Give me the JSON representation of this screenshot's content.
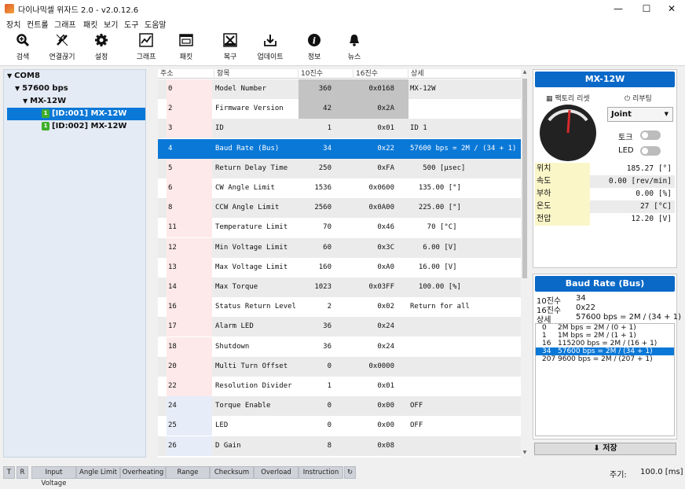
{
  "window": {
    "title": "다이나믹셀 위자드 2.0 - v2.0.12.6",
    "controls": [
      "—",
      "☐",
      "✕"
    ]
  },
  "menu": [
    "장치",
    "컨트롤",
    "그래프",
    "패킷",
    "보기",
    "도구",
    "도움말"
  ],
  "toolbar": {
    "items": [
      {
        "label": "검색",
        "icon": "search-icon"
      },
      {
        "label": "연결끊기",
        "icon": "disconnect-icon"
      },
      {
        "label": "설정",
        "icon": "gear-icon"
      },
      {
        "label": "그래프",
        "icon": "graph-icon"
      },
      {
        "label": "패킷",
        "icon": "packet-icon"
      },
      {
        "label": "복구",
        "icon": "recovery-icon"
      },
      {
        "label": "업데이트",
        "icon": "update-icon"
      },
      {
        "label": "정보",
        "icon": "info-icon"
      },
      {
        "label": "뉴스",
        "icon": "bell-icon"
      }
    ]
  },
  "tree": {
    "port": "COM8",
    "baud": "57600 bps",
    "model": "MX-12W",
    "devices": [
      {
        "label": "[ID:001] MX-12W",
        "badge": "1",
        "selected": true
      },
      {
        "label": "[ID:002] MX-12W",
        "badge": "1",
        "selected": false
      }
    ]
  },
  "table": {
    "headers": [
      "주소",
      "항목",
      "10진수",
      "16진수",
      "상세"
    ],
    "rows": [
      {
        "addr": "0",
        "name": "Model Number",
        "dec": "360",
        "hex": "0x0168",
        "detail": "MX-12W",
        "ro": true
      },
      {
        "addr": "2",
        "name": "Firmware Version",
        "dec": "42",
        "hex": "0x2A",
        "detail": "",
        "ro": true
      },
      {
        "addr": "3",
        "name": "ID",
        "dec": "1",
        "hex": "0x01",
        "detail": "ID 1"
      },
      {
        "addr": "4",
        "name": "Baud Rate (Bus)",
        "dec": "34",
        "hex": "0x22",
        "detail": "57600 bps = 2M / (34 + 1)",
        "selected": true
      },
      {
        "addr": "5",
        "name": "Return Delay Time",
        "dec": "250",
        "hex": "0xFA",
        "detail": "   500 [µsec]"
      },
      {
        "addr": "6",
        "name": "CW Angle Limit",
        "dec": "1536",
        "hex": "0x0600",
        "detail": "  135.00 [°]"
      },
      {
        "addr": "8",
        "name": "CCW Angle Limit",
        "dec": "2560",
        "hex": "0x0A00",
        "detail": "  225.00 [°]"
      },
      {
        "addr": "11",
        "name": "Temperature Limit",
        "dec": "70",
        "hex": "0x46",
        "detail": "    70 [°C]"
      },
      {
        "addr": "12",
        "name": "Min Voltage Limit",
        "dec": "60",
        "hex": "0x3C",
        "detail": "   6.00 [V]"
      },
      {
        "addr": "13",
        "name": "Max Voltage Limit",
        "dec": "160",
        "hex": "0xA0",
        "detail": "  16.00 [V]"
      },
      {
        "addr": "14",
        "name": "Max Torque",
        "dec": "1023",
        "hex": "0x03FF",
        "detail": "  100.00 [%]"
      },
      {
        "addr": "16",
        "name": "Status Return Level",
        "dec": "2",
        "hex": "0x02",
        "detail": "Return for all"
      },
      {
        "addr": "17",
        "name": "Alarm LED",
        "dec": "36",
        "hex": "0x24",
        "detail": ""
      },
      {
        "addr": "18",
        "name": "Shutdown",
        "dec": "36",
        "hex": "0x24",
        "detail": ""
      },
      {
        "addr": "20",
        "name": "Multi Turn Offset",
        "dec": "0",
        "hex": "0x0000",
        "detail": ""
      },
      {
        "addr": "22",
        "name": "Resolution Divider",
        "dec": "1",
        "hex": "0x01",
        "detail": ""
      },
      {
        "addr": "24",
        "name": "Torque Enable",
        "dec": "0",
        "hex": "0x00",
        "detail": "OFF",
        "ram": true
      },
      {
        "addr": "25",
        "name": "LED",
        "dec": "0",
        "hex": "0x00",
        "detail": "OFF",
        "ram": true
      },
      {
        "addr": "26",
        "name": "D Gain",
        "dec": "8",
        "hex": "0x08",
        "detail": "",
        "ram": true
      }
    ]
  },
  "device_panel": {
    "title": "MX-12W",
    "factory_reset": "팩토리 리셋",
    "reboot": "리부팅",
    "mode": "Joint",
    "torque_label": "토크",
    "led_label": "LED",
    "torque_on": false,
    "led_on": false,
    "status": [
      {
        "label": "위치",
        "value": "185.27 [°]"
      },
      {
        "label": "속도",
        "value": "0.00 [rev/min]"
      },
      {
        "label": "부하",
        "value": "0.00 [%]"
      },
      {
        "label": "온도",
        "value": "27 [°C]"
      },
      {
        "label": "전압",
        "value": "12.20 [V]"
      }
    ]
  },
  "item_panel": {
    "title": "Baud Rate (Bus)",
    "dec_label": "10진수",
    "dec_value": "34",
    "hex_label": "16진수",
    "hex_value": "0x22",
    "detail_label": "상세",
    "detail_value": "57600 bps = 2M / (34 + 1)",
    "options": [
      {
        "k": "0",
        "v": "2M bps = 2M / (0 + 1)"
      },
      {
        "k": "1",
        "v": "1M bps = 2M / (1 + 1)"
      },
      {
        "k": "16",
        "v": "115200 bps = 2M / (16 + 1)"
      },
      {
        "k": "34",
        "v": "57600 bps = 2M / (34 + 1)",
        "selected": true
      },
      {
        "k": "207",
        "v": "9600 bps = 2M / (207 + 1)"
      }
    ],
    "save_label": "저장"
  },
  "statusbar": {
    "t_btn": "T",
    "r_btn": "R",
    "flags": [
      "Input Voltage",
      "Angle Limit",
      "Overheating",
      "Range",
      "Checksum",
      "Overload",
      "Instruction"
    ],
    "refresh_icon": "refresh-icon",
    "period_label": "주기:",
    "period_value": "100.0 [ms]"
  },
  "colors": {
    "accent": "#0a78d7",
    "panel_title": "#0a68c7",
    "eeprom_addr": "#fde9e9",
    "ram_addr": "#e6edf8",
    "readonly": "#c3c3c3",
    "status_label": "#fbf6c8",
    "tree_bg": "#e4ebf5"
  }
}
